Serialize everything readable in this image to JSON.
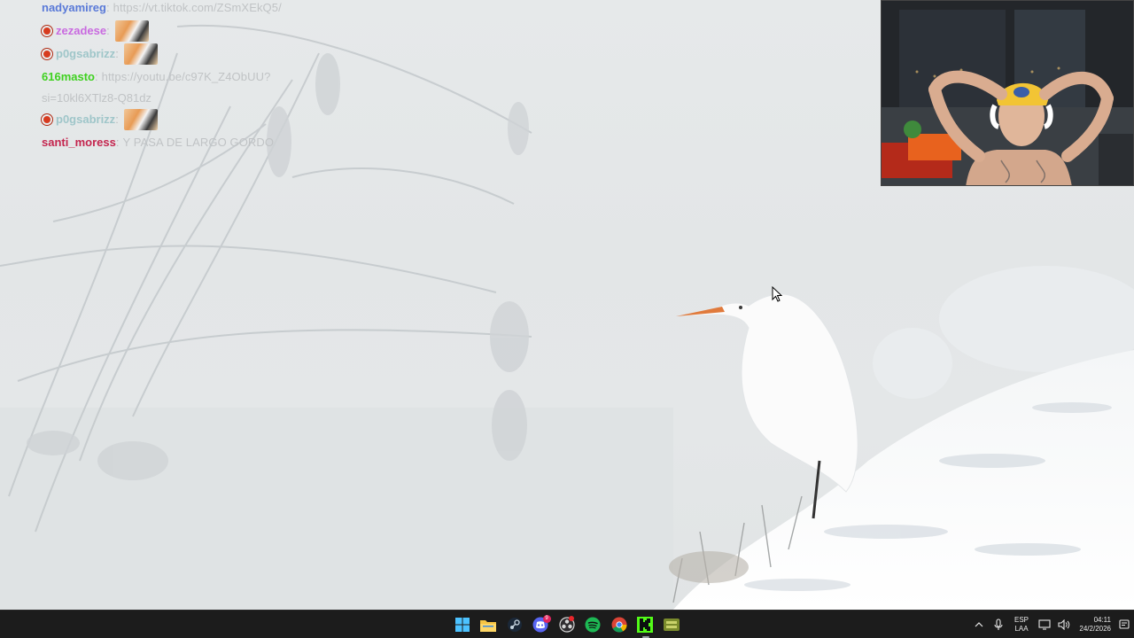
{
  "chat": {
    "messages": [
      {
        "user": "nadyamireg",
        "user_color": "#5a7ad8",
        "text": "https://vt.tiktok.com/ZSmXEkQ5/",
        "badge": false,
        "emote": false
      },
      {
        "user": "zezadese",
        "user_color": "#c96ae0",
        "text": "",
        "badge": true,
        "emote": true
      },
      {
        "user": "p0gsabrizz",
        "user_color": "#9fc6c9",
        "text": "",
        "badge": true,
        "emote": true
      },
      {
        "user": "616masto",
        "user_color": "#3fd120",
        "text": "https://youtu.be/c97K_Z4ObUU?",
        "text_cont": "si=10kl6XTlz8-Q81dz",
        "badge": false,
        "emote": false
      },
      {
        "user": "p0gsabrizz",
        "user_color": "#9fc6c9",
        "text": "",
        "badge": true,
        "emote": true
      },
      {
        "user": "santi_moress",
        "user_color": "#c4254e",
        "text": "Y PASA DE LARGO GORDO",
        "badge": false,
        "emote": false
      }
    ]
  },
  "taskbar": {
    "apps": [
      {
        "name": "start-button",
        "icon": "windows-icon"
      },
      {
        "name": "file-explorer-button",
        "icon": "folder-icon"
      },
      {
        "name": "steam-button",
        "icon": "steam-icon"
      },
      {
        "name": "discord-button",
        "icon": "discord-icon",
        "badge": "9"
      },
      {
        "name": "obs-button",
        "icon": "obs-icon"
      },
      {
        "name": "spotify-button",
        "icon": "spotify-icon"
      },
      {
        "name": "chrome-button",
        "icon": "chrome-icon"
      },
      {
        "name": "kick-button",
        "icon": "kick-icon"
      },
      {
        "name": "app-button",
        "icon": "app-icon"
      }
    ],
    "tray": {
      "lang_top": "ESP",
      "lang_bottom": "LAA",
      "time": "04:11",
      "date": "24/2/2026"
    }
  },
  "colors": {
    "taskbar_bg": "#1c1c1c",
    "kick_green": "#53fc18",
    "spotify_green": "#1db954",
    "discord_blurple": "#5865f2"
  }
}
